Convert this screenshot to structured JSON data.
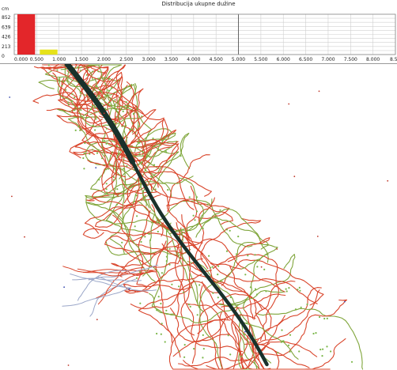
{
  "histogram": {
    "title": "Distribucija ukupne dužine",
    "unit_label": "cm",
    "y_tick_labels": [
      "852",
      "639",
      "426",
      "213",
      "0"
    ],
    "x_tick_labels": [
      "0.000",
      "0.500",
      "1.000",
      "1.500",
      "2.000",
      "2.500",
      "3.000",
      "3.500",
      "4.000",
      "4.500",
      "5.000",
      "5.500",
      "6.000",
      "6.500",
      "7.000",
      "7.500",
      "8.000",
      "8.5"
    ]
  },
  "chart_data": {
    "type": "bar",
    "title": "Distribucija ukupne dužine",
    "ylabel": "cm",
    "xlim": [
      0,
      8.5
    ],
    "ylim": [
      0,
      852
    ],
    "bins": [
      {
        "x0": 0.0,
        "x1": 0.5,
        "value": 852,
        "color": "#e3262a"
      },
      {
        "x0": 0.5,
        "x1": 1.0,
        "value": 105,
        "color": "#e6e21a"
      }
    ]
  },
  "root_image": {
    "colors": {
      "main_root": "#19312b",
      "lateral_root": "#d9452b",
      "lateral_root_alt": "#7fa53a",
      "junction": "#7ab648",
      "background": "#ffffff"
    }
  }
}
